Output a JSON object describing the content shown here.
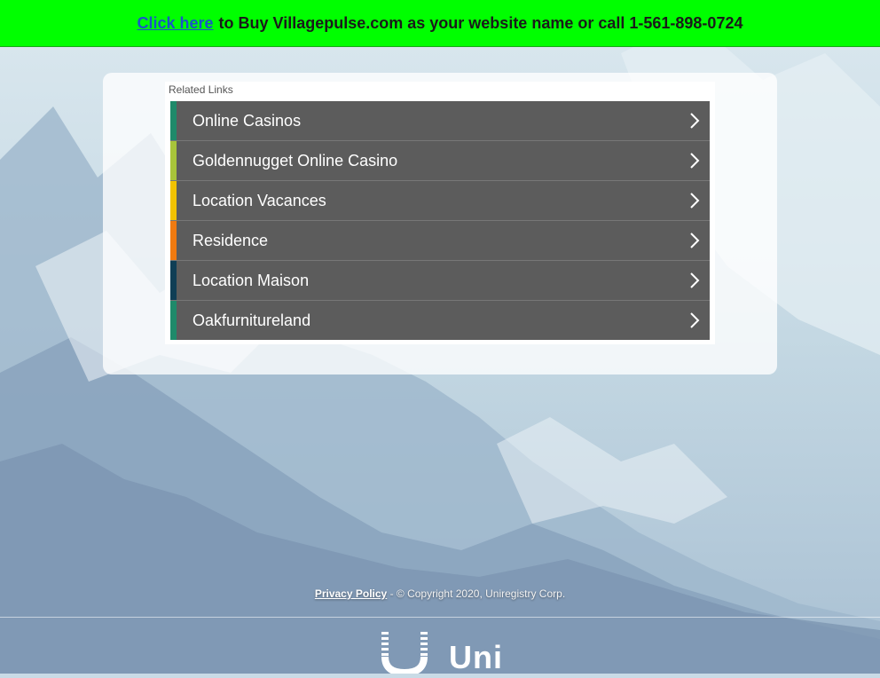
{
  "banner": {
    "link_label": "Click here",
    "message": "to Buy Villagepulse.com as your website name or call 1-561-898-0724",
    "background": "#00ff00"
  },
  "related": {
    "title": "Related Links",
    "items": [
      {
        "label": "Online Casinos",
        "color": "#1f8a6a"
      },
      {
        "label": "Goldennugget Online Casino",
        "color": "#a8c43a"
      },
      {
        "label": "Location Vacances",
        "color": "#f2c200"
      },
      {
        "label": "Residence",
        "color": "#f07a10"
      },
      {
        "label": "Location Maison",
        "color": "#0f3e55"
      },
      {
        "label": "Oakfurnitureland",
        "color": "#1f8a6a"
      }
    ]
  },
  "footer": {
    "privacy_label": "Privacy Policy",
    "copyright": "- © Copyright 2020, Uniregistry Corp."
  },
  "logo": {
    "text": "Uni"
  }
}
